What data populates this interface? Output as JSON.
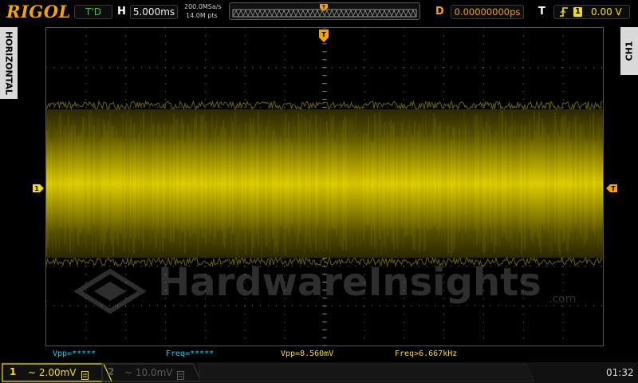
{
  "header": {
    "logo": "RIGOL",
    "run_state": "T'D",
    "h_label": "H",
    "timebase": "5.000ms",
    "sample_rate": "200.0MSa/s",
    "memory_depth": "14.0M pts",
    "d_label": "D",
    "delay": "0.00000000ps",
    "t_label": "T",
    "trigger_source": "1",
    "trigger_level": "0.00 V"
  },
  "side": {
    "left_tab": "HORIZONTAL",
    "right_tab": "CH1"
  },
  "markers": {
    "ch1_marker": "1",
    "trigger_marker": "T",
    "trigger_level_marker": "T"
  },
  "measurements": [
    {
      "label": "Vpp=*****",
      "color": "#00d4ff"
    },
    {
      "label": "Freq=*****",
      "color": "#00d4ff"
    },
    {
      "label": "Vpp=8.560mV",
      "color": "#f4e000"
    },
    {
      "label": "Freq>6.667kHz",
      "color": "#f4e000"
    }
  ],
  "watermark": {
    "text": "HardwareInsights",
    "suffix": ".com"
  },
  "footer": {
    "ch1_num": "1",
    "ch1_scale": "~ 2.00mV",
    "ch2_num": "2",
    "ch2_scale": "~ 10.0mV",
    "clock": "01:32"
  },
  "colors": {
    "ch1": "#f4e000",
    "trigger": "#f4a300",
    "run": "#2ecc40",
    "ch2_disabled": "#5a5a5a"
  },
  "icons": {
    "trigger_edge": "rising-edge-icon",
    "coupling": "dc-coupling-icon"
  }
}
